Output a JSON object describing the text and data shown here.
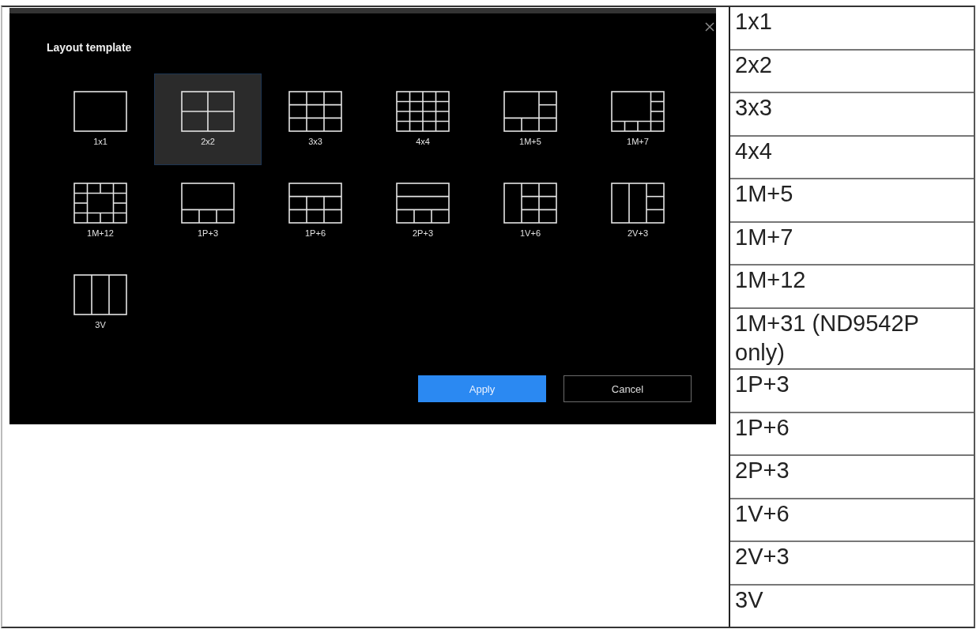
{
  "dialog": {
    "title": "Layout template",
    "layouts": [
      {
        "label": "1x1",
        "selected": false
      },
      {
        "label": "2x2",
        "selected": true
      },
      {
        "label": "3x3",
        "selected": false
      },
      {
        "label": "4x4",
        "selected": false
      },
      {
        "label": "1M+5",
        "selected": false
      },
      {
        "label": "1M+7",
        "selected": false
      },
      {
        "label": "1M+12",
        "selected": false
      },
      {
        "label": "1P+3",
        "selected": false
      },
      {
        "label": "1P+6",
        "selected": false
      },
      {
        "label": "2P+3",
        "selected": false
      },
      {
        "label": "1V+6",
        "selected": false
      },
      {
        "label": "2V+3",
        "selected": false
      },
      {
        "label": "3V",
        "selected": false
      }
    ],
    "buttons": [
      {
        "label": "Apply",
        "kind": "primary"
      },
      {
        "label": "Cancel",
        "kind": "secondary"
      }
    ]
  },
  "table": {
    "column_2": [
      "1x1",
      "2x2",
      "3x3",
      "4x4",
      "1M+5",
      "1M+7",
      "1M+12",
      "1M+31 (ND9542P only)",
      "1P+3",
      "1P+6",
      "2P+3",
      "1V+6",
      "2V+3",
      "3V"
    ]
  }
}
